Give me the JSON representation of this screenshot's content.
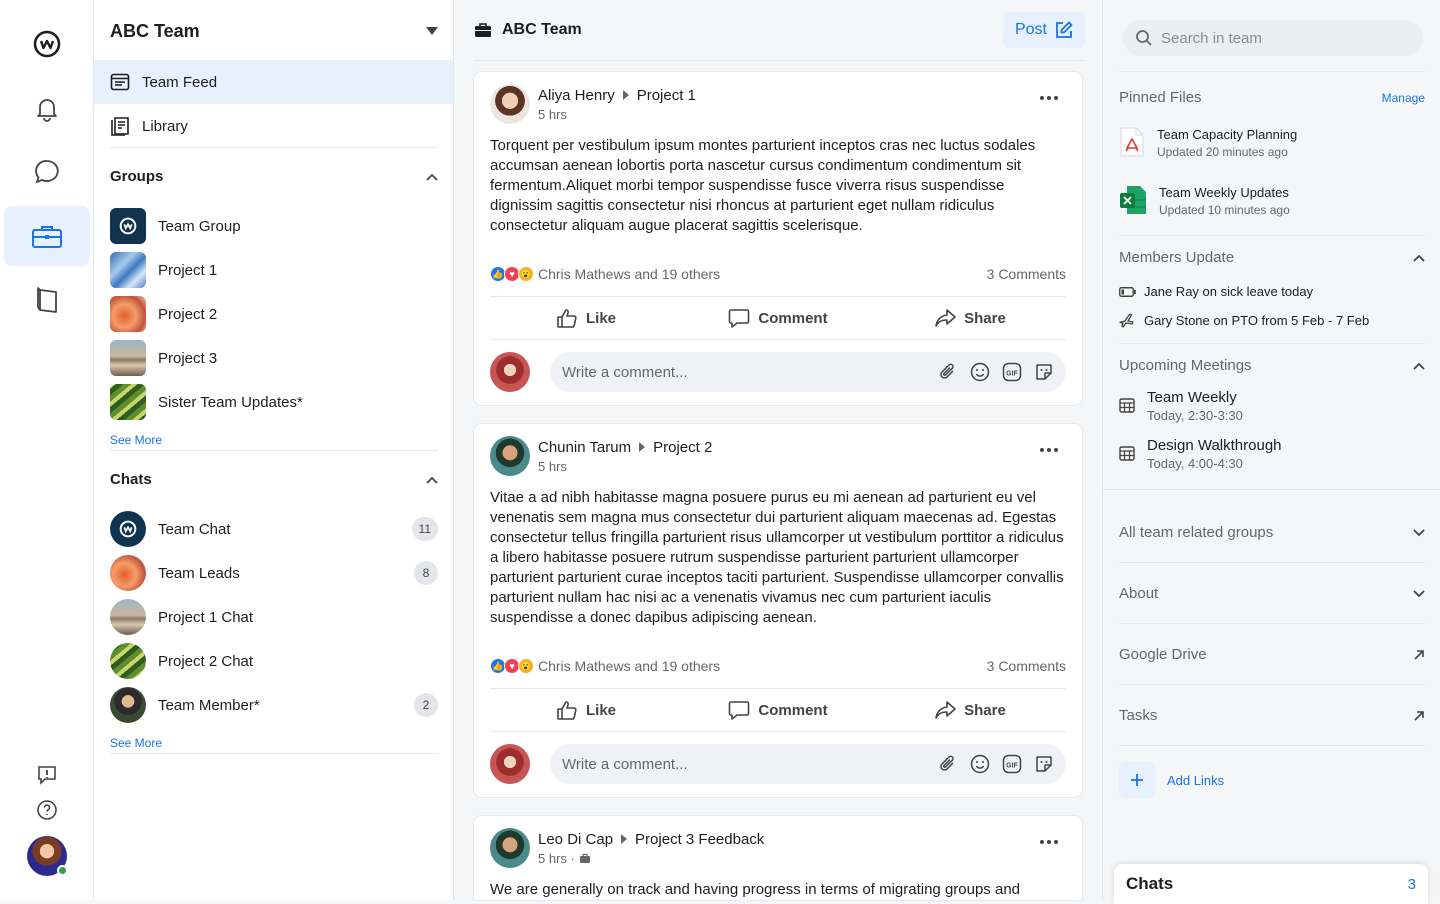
{
  "left": {
    "team_name": "ABC Team",
    "nav": [
      {
        "label": "Team Feed"
      },
      {
        "label": "Library"
      }
    ],
    "groups_title": "Groups",
    "groups": [
      {
        "label": "Team Group"
      },
      {
        "label": "Project 1"
      },
      {
        "label": "Project 2"
      },
      {
        "label": "Project 3"
      },
      {
        "label": "Sister Team Updates*"
      }
    ],
    "groups_see_more": "See More",
    "chats_title": "Chats",
    "chats": [
      {
        "label": "Team Chat",
        "badge": "11"
      },
      {
        "label": "Team Leads",
        "badge": "8"
      },
      {
        "label": "Project 1 Chat",
        "badge": ""
      },
      {
        "label": "Project 2 Chat",
        "badge": ""
      },
      {
        "label": "Team Member*",
        "badge": "2"
      }
    ],
    "chats_see_more": "See More"
  },
  "feed": {
    "title": "ABC Team",
    "post_button": "Post",
    "posts": [
      {
        "author": "Aliya Henry",
        "target": "Project 1",
        "time": "5 hrs",
        "body": "Torquent per vestibulum ipsum montes parturient inceptos cras nec luctus sodales accumsan aenean lobortis porta nascetur cursus condimentum condimentum sit fermentum.Aliquet morbi tempor suspendisse fusce viverra risus suspendisse dignissim sagittis consectetur nisi rhoncus at parturient eget nullam ridiculus consectetur aliquam augue placerat sagittis scelerisque.",
        "reactions": "Chris Mathews and 19 others",
        "comments": "3 Comments"
      },
      {
        "author": "Chunin Tarum",
        "target": "Project 2",
        "time": "5 hrs",
        "body": "Vitae a ad nibh habitasse magna posuere purus eu mi aenean ad parturient eu vel venenatis sem magna mus consectetur dui parturient aliquam maecenas ad. Egestas consectetur tellus fringilla parturient risus ullamcorper ut vestibulum porttitor a ridiculus a libero habitasse posuere rutrum suspendisse parturient parturient ullamcorper parturient parturient curae inceptos taciti parturient. Suspendisse ullamcorper convallis parturient nullam hac nisi ac a venenatis vivamus nec cum parturient iaculis suspendisse a donec dapibus adipiscing aenean.",
        "reactions": "Chris Mathews and 19 others",
        "comments": "3 Comments"
      },
      {
        "author": "Leo Di Cap",
        "target": "Project 3 Feedback",
        "time": "5 hrs ·",
        "body": "We are generally on track and having progress in terms of migrating groups and"
      }
    ],
    "actions": {
      "like": "Like",
      "comment": "Comment",
      "share": "Share"
    },
    "comment_placeholder": "Write a comment..."
  },
  "right": {
    "search_placeholder": "Search in team",
    "pinned_title": "Pinned Files",
    "manage": "Manage",
    "files": [
      {
        "name": "Team Capacity Planning",
        "updated": "Updated 20 minutes ago"
      },
      {
        "name": "Team Weekly Updates",
        "updated": "Updated 10 minutes ago"
      }
    ],
    "members_title": "Members Update",
    "members": [
      {
        "text": "Jane Ray on sick leave today"
      },
      {
        "text": "Gary Stone on PTO from 5 Feb - 7 Feb"
      }
    ],
    "meetings_title": "Upcoming Meetings",
    "meetings": [
      {
        "name": "Team Weekly",
        "time": "Today, 2:30-3:30"
      },
      {
        "name": "Design Walkthrough",
        "time": "Today, 4:00-4:30"
      }
    ],
    "collapsed": [
      {
        "label": "All team related groups"
      },
      {
        "label": "About"
      },
      {
        "label": "Google Drive"
      },
      {
        "label": "Tasks"
      }
    ],
    "add_links": "Add Links"
  },
  "chats_bar": {
    "label": "Chats",
    "count": "3"
  },
  "colors": {
    "accent": "#1a73e8",
    "active_bg": "#e7f1fd"
  },
  "icons": [
    "workplace-logo-icon",
    "bell-icon",
    "chat-bubble-icon",
    "briefcase-icon",
    "book-icon",
    "feedback-icon",
    "help-icon",
    "feed-icon",
    "library-icon",
    "search-icon",
    "pdf-icon",
    "excel-icon",
    "battery-icon",
    "plane-icon",
    "calendar-icon",
    "chevron-up-icon",
    "chevron-down-icon",
    "external-link-icon",
    "plus-icon",
    "edit-icon",
    "more-icon",
    "like-icon",
    "comment-icon",
    "share-icon",
    "attach-icon",
    "emoji-icon",
    "gif-icon",
    "sticker-icon"
  ]
}
